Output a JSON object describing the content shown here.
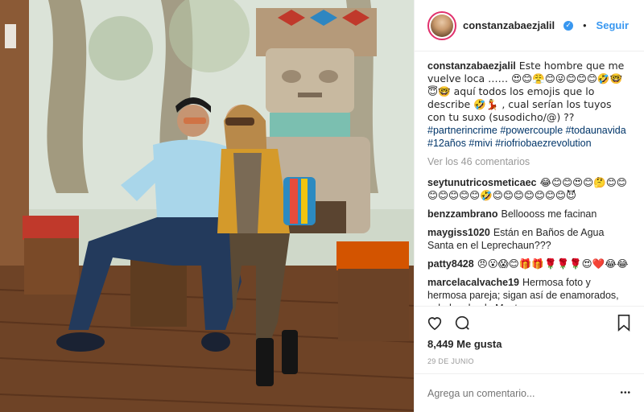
{
  "photo": {
    "alt": ""
  },
  "header": {
    "username": "constanzabaezjalil",
    "follow_label": "Seguir",
    "dot": "•"
  },
  "caption": {
    "username": "constanzabaezjalil",
    "text": "Este hombre que me vuelve loca …… 😍😊😤😊😜😊😊😊🤣🤓😇🤓 aquí todos los emojis que lo describe 🤣💃 , cual serían los tuyos con tu suxo (susodicho/@) ??",
    "hashtags": "#partnerincrime #powercouple #todaunavida #12años #mivi #riofriobaezrevolution"
  },
  "view_comments": "Ver los 46 comentarios",
  "comments": [
    {
      "user": "seytunutricosmeticaec",
      "text": "😂😊😊😍😊🤔😊😊😊😊😊😊😊🤣😊😊😊😊😊😊😊😈"
    },
    {
      "user": "benzzambrano",
      "text": "Belloooss me facinan"
    },
    {
      "user": "maygiss1020",
      "text": "Están en Baños de Agua Santa en el Leprechaun???"
    },
    {
      "user": "patty8428",
      "text": "😠😮😱😊🎁🎁🌹🌹🌹😍❤️😂😂"
    },
    {
      "user": "marcelacalvache19",
      "text": "Hermosa foto y hermosa pareja; sigan así de enamorados, saludos desde Manta."
    }
  ],
  "likes": "8,449 Me gusta",
  "date": "29 DE JUNIO",
  "add_comment": {
    "placeholder": "Agrega un comentario...",
    "more": "•••"
  },
  "colors": {
    "link": "#3897f0",
    "hashtag": "#003569",
    "muted": "#999999"
  }
}
